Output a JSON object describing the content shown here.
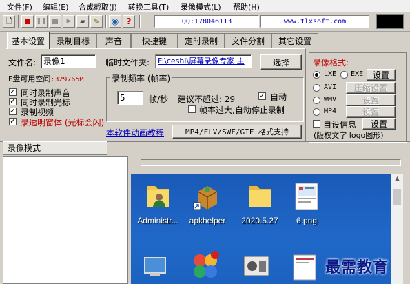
{
  "menu": [
    "文件(F)",
    "编辑(E)",
    "合成截取(J)",
    "转换工具(T)",
    "录像模式(L)",
    "帮助(H)"
  ],
  "toolbar": {
    "qq": "QQ:178046113",
    "website": "www.tlxsoft.com"
  },
  "tabs": [
    "基本设置",
    "录制目标",
    "声音",
    "快捷键",
    "定时录制",
    "文件分割",
    "其它设置"
  ],
  "basic": {
    "filename_label": "文件名:",
    "filename_value": "录像1",
    "temp_folder_label": "临时文件夹:",
    "temp_folder_value": "F:\\ceshi\\屏幕录像专家 主",
    "browse_button": "选择",
    "free_space_label": "F盘可用空间",
    "free_space_value": ":329765M",
    "checkboxes": [
      {
        "label": "同时录制声音",
        "checked": true
      },
      {
        "label": "同时录制光标",
        "checked": true
      },
      {
        "label": "录制视频",
        "checked": true
      },
      {
        "label": "录透明窗体 (光标会闪)",
        "checked": true
      }
    ],
    "rate_group_title": "录制频率 (帧率)",
    "fps_value": "5",
    "fps_unit": "帧/秒",
    "suggest_text": "建议不超过: 29",
    "auto_label": "自动",
    "auto_checked": true,
    "auto_stop_label": "帧率过大,自动停止录制",
    "auto_stop_checked": false,
    "tutorial_link": "本软件动画教程",
    "format_support_button": "MP4/FLV/SWF/GIF  格式支持"
  },
  "format": {
    "title": "录像格式:",
    "options": [
      {
        "label": "LXE",
        "selected": true
      },
      {
        "label": "EXE",
        "selected": false
      },
      {
        "label": "AVI",
        "selected": false
      },
      {
        "label": "WMV",
        "selected": false
      },
      {
        "label": "MP4",
        "selected": false
      }
    ],
    "settings_button": "设置",
    "compress_button": "压缩设置",
    "settings2_button": "设置",
    "settings3_button": "设置",
    "custom_info_label": "自设信息",
    "custom_info_button": "设置",
    "custom_info_note": "(版权文字 logo图形)"
  },
  "left_tab": "录像模式",
  "desktop_icons": [
    {
      "label": "Administr...",
      "icon": "user-folder-icon"
    },
    {
      "label": "apkhelper",
      "icon": "package-icon"
    },
    {
      "label": "2020.5.27",
      "icon": "folder-icon"
    },
    {
      "label": "6.png",
      "icon": "image-file-icon"
    }
  ],
  "watermark": "最需教育",
  "colors": {
    "info_text": "#0000c0",
    "free_space": "#c00000",
    "format_title": "#c00000",
    "desktop_bg": "#1e5ebf"
  }
}
